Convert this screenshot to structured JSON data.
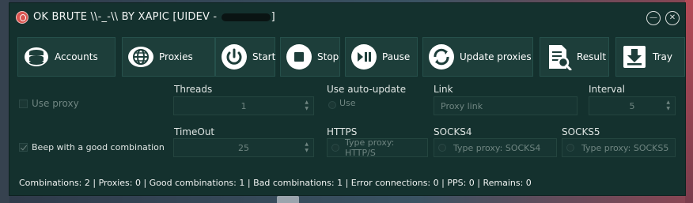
{
  "window": {
    "title_prefix": "OK BRUTE \\\\-_-\\\\ BY XAPIC [UIDEV -",
    "title_suffix": "]",
    "minimize_glyph": "—",
    "close_glyph": "✕"
  },
  "toolbar": {
    "accounts": "Accounts",
    "proxies": "Proxies",
    "start": "Start",
    "stop": "Stop",
    "pause": "Pause",
    "update_proxies": "Update proxies",
    "result": "Result",
    "tray": "Tray"
  },
  "options": {
    "use_proxy": "Use proxy",
    "threads_label": "Threads",
    "threads_value": "1",
    "auto_update_label": "Use auto-update",
    "use_label": "Use",
    "link_label": "Link",
    "link_placeholder": "Proxy link",
    "interval_label": "Interval",
    "interval_value": "5",
    "beep": "Beep with a good combination",
    "timeout_label": "TimeOut",
    "timeout_value": "25",
    "https_label": "HTTPS",
    "https_type": "Type proxy: HTTP/S",
    "socks4_label": "SOCKS4",
    "socks4_type": "Type proxy: SOCKS4",
    "socks5_label": "SOCKS5",
    "socks5_type": "Type proxy: SOCKS5",
    "spin_up": "▲",
    "spin_down": "▼"
  },
  "status": {
    "text": "Combinations: 2 | Proxies: 0 | Good combinations: 1 | Bad combinations: 1 | Error connections: 0 | PPS: 0 | Remains: 0"
  }
}
